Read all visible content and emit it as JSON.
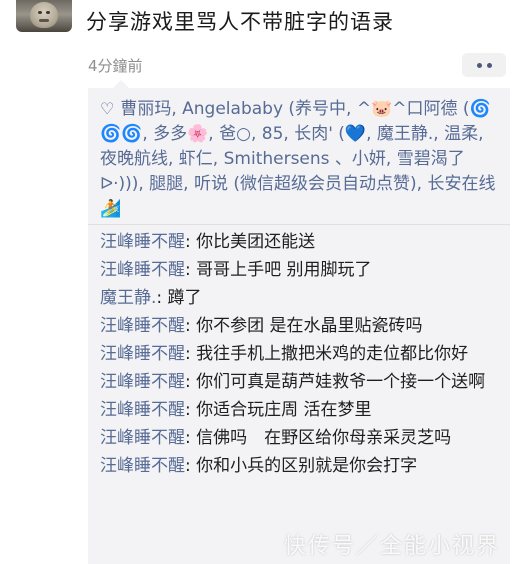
{
  "post": {
    "title": "分享游戏里骂人不带脏字的语录",
    "timestamp": "4分鐘前"
  },
  "likes": {
    "names_line": "曹丽玛, Angelababy (养号中, ^🐷^口阿德 (🌀🌀🌀, 多多🌸, 爸○, 85, 长肉' (💙, 魔王静., 温柔, 夜晚航线, 虾仁, Smithersens 、小妍, 雪碧渴了ᐅ·))), 腿腿, 听说 (微信超级会员自动点赞), 长安在线🏄"
  },
  "comments": [
    {
      "name": "汪峰睡不醒",
      "text": ": 你比美团还能送"
    },
    {
      "name": "汪峰睡不醒",
      "text": ": 哥哥上手吧 别用脚玩了"
    },
    {
      "name": "魔王静.",
      "text": ": 蹲了"
    },
    {
      "name": "汪峰睡不醒",
      "text": ": 你不参团 是在水晶里贴瓷砖吗"
    },
    {
      "name": "汪峰睡不醒",
      "text": ": 我往手机上撒把米鸡的走位都比你好"
    },
    {
      "name": "汪峰睡不醒",
      "text": ": 你们可真是葫芦娃救爷一个接一个送啊"
    },
    {
      "name": "汪峰睡不醒",
      "text": ": 你适合玩庄周 活在梦里"
    },
    {
      "name": "汪峰睡不醒",
      "text": ": 信佛吗　在野区给你母亲采灵芝吗"
    },
    {
      "name": "汪峰睡不醒",
      "text": ": 你和小兵的区别就是你会打字"
    }
  ],
  "watermark": "快传号／全能小视界"
}
